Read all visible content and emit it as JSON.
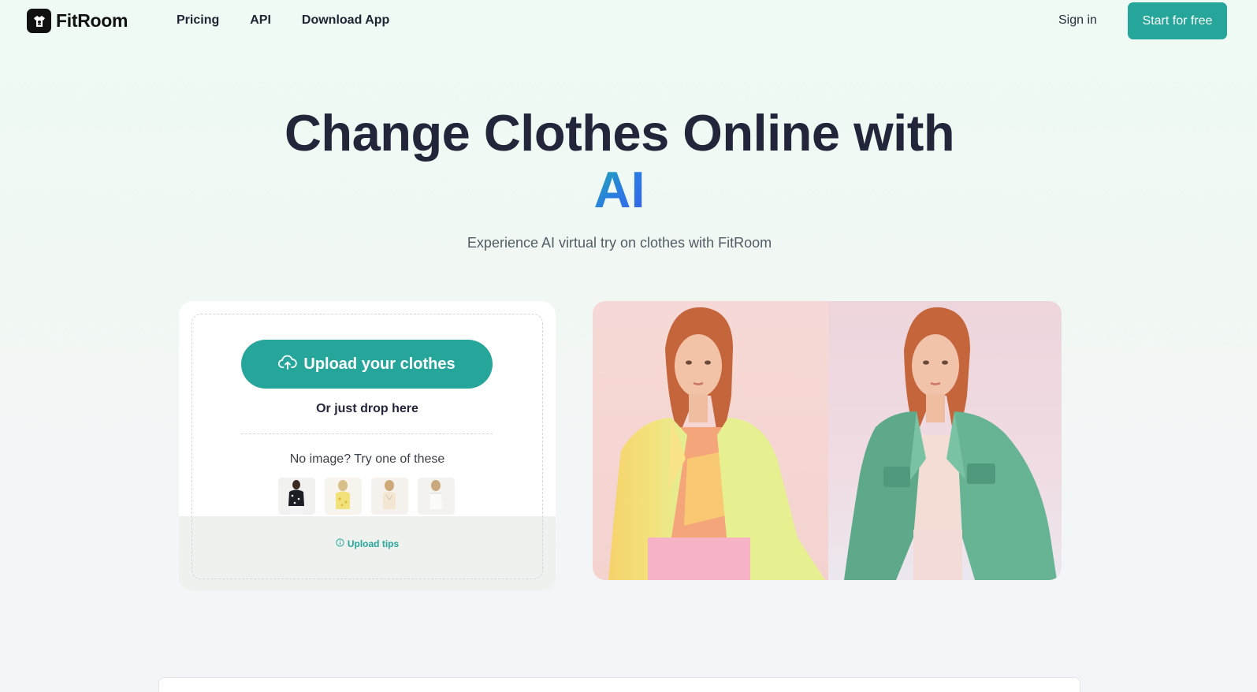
{
  "brand": {
    "name": "FitRoom",
    "accent": "#26a69a"
  },
  "nav": {
    "links": [
      "Pricing",
      "API",
      "Download App"
    ],
    "signin": "Sign in",
    "cta": "Start for free"
  },
  "hero": {
    "title_line1": "Change Clothes Online with",
    "title_line2": "AI",
    "subtitle": "Experience AI virtual try on clothes with FitRoom"
  },
  "upload": {
    "button_label": "Upload your clothes",
    "button_icon": "cloud-upload-icon",
    "drop_text": "Or just drop here",
    "samples_heading": "No image? Try one of these",
    "samples": [
      "black floral top",
      "yellow floral top",
      "cream blouse",
      "white corset top"
    ],
    "tips_label": "Upload tips",
    "tips_icon": "info-icon"
  },
  "preview": {
    "before": "model in yellow-green blazer",
    "after": "model in green denim jacket"
  }
}
